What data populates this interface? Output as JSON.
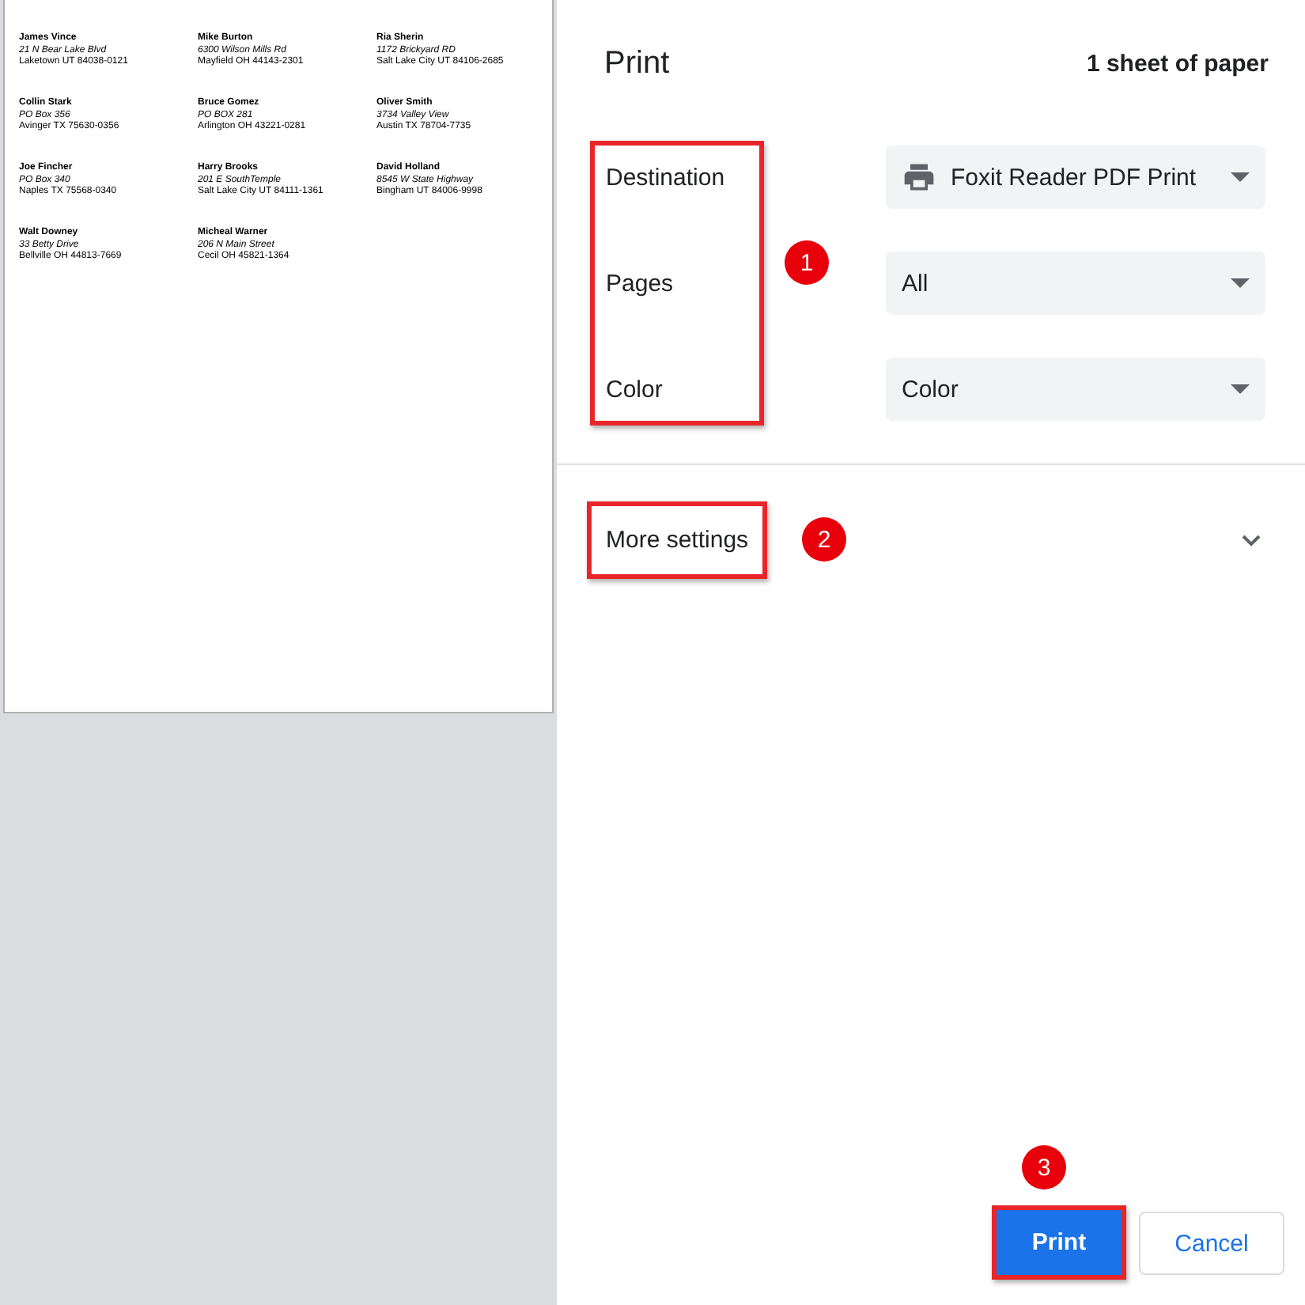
{
  "preview": {
    "labels": [
      {
        "name": "James Vince",
        "street": "21 N Bear Lake Blvd",
        "city": "Laketown UT 84038-0121"
      },
      {
        "name": "Mike Burton",
        "street": "6300 Wilson Mills Rd",
        "city": "Mayfield OH 44143-2301"
      },
      {
        "name": "Ria Sherin",
        "street": "1172 Brickyard RD",
        "city": "Salt Lake City UT  84106-2685"
      },
      {
        "name": "Collin Stark",
        "street": "PO Box 356",
        "city": "Avinger TX 75630-0356"
      },
      {
        "name": "Bruce Gomez",
        "street": "PO BOX 281",
        "city": "Arlington OH 43221-0281"
      },
      {
        "name": "Oliver Smith",
        "street": "3734 Valley View",
        "city": "Austin TX 78704-7735"
      },
      {
        "name": "Joe Fincher",
        "street": "PO Box 340",
        "city": "Naples TX 75568-0340"
      },
      {
        "name": "Harry Brooks",
        "street": "201 E SouthTemple",
        "city": "Salt Lake City UT 84111-1361"
      },
      {
        "name": "David Holland",
        "street": "8545 W State Highway",
        "city": "Bingham UT 84006-9998"
      },
      {
        "name": "Walt Downey",
        "street": "33 Betty Drive",
        "city": "Bellville OH 44813-7669"
      },
      {
        "name": "Micheal Warner",
        "street": "206 N Main Street",
        "city": "Cecil OH 45821-1364"
      }
    ]
  },
  "panel": {
    "title": "Print",
    "sheets": "1 sheet of paper"
  },
  "settings": {
    "highlighted": true,
    "callout": "1",
    "rows": [
      {
        "label": "Destination",
        "value": "Foxit Reader PDF Print",
        "kind": "printer"
      },
      {
        "label": "Pages",
        "value": "All",
        "kind": "plain"
      },
      {
        "label": "Color",
        "value": "Color",
        "kind": "plain"
      }
    ]
  },
  "more_settings": {
    "label": "More settings",
    "expanded": false,
    "highlighted": true,
    "callout": "2"
  },
  "buttons": {
    "print": {
      "label": "Print",
      "highlighted": true,
      "callout": "3"
    },
    "cancel": {
      "label": "Cancel"
    }
  }
}
